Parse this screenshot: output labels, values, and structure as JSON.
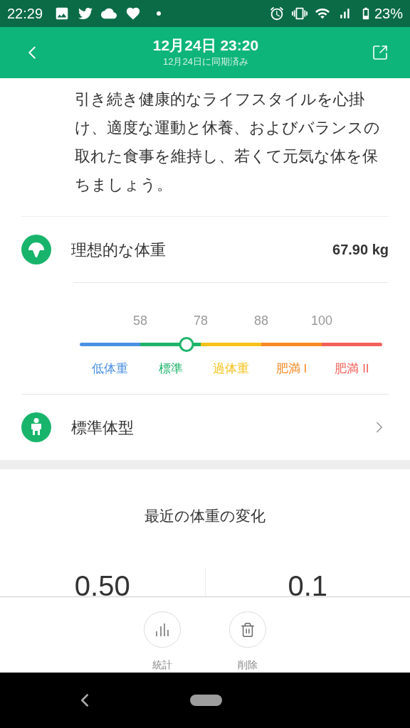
{
  "status_bar": {
    "time": "22:29",
    "battery": "23%"
  },
  "header": {
    "title": "12月24日 23:20",
    "subtitle": "12月24日に同期済み"
  },
  "advice": "引き続き健康的なライフスタイルを心掛け、適度な運動と休養、およびバランスの取れた食事を維持し、若くて元気な体を保ちましょう。",
  "ideal_weight": {
    "label": "理想的な体重",
    "value": "67.90 kg"
  },
  "scale": {
    "ticks": [
      "58",
      "78",
      "88",
      "100"
    ],
    "level": 0.353,
    "segments": [
      {
        "label": "低体重",
        "color": "#4a90e2"
      },
      {
        "label": "標準",
        "color": "#1db46a"
      },
      {
        "label": "過体重",
        "color": "#f7c21b"
      },
      {
        "label": "肥満 I",
        "color": "#f78a26"
      },
      {
        "label": "肥満 II",
        "color": "#f2605a"
      }
    ]
  },
  "body_type": {
    "label": "標準体型"
  },
  "recent_change": {
    "title": "最近の体重の変化",
    "values": [
      "0.50",
      "0.1"
    ]
  },
  "toolbar": [
    {
      "kind": "stats",
      "label": "統計"
    },
    {
      "kind": "delete",
      "label": "削除"
    }
  ]
}
